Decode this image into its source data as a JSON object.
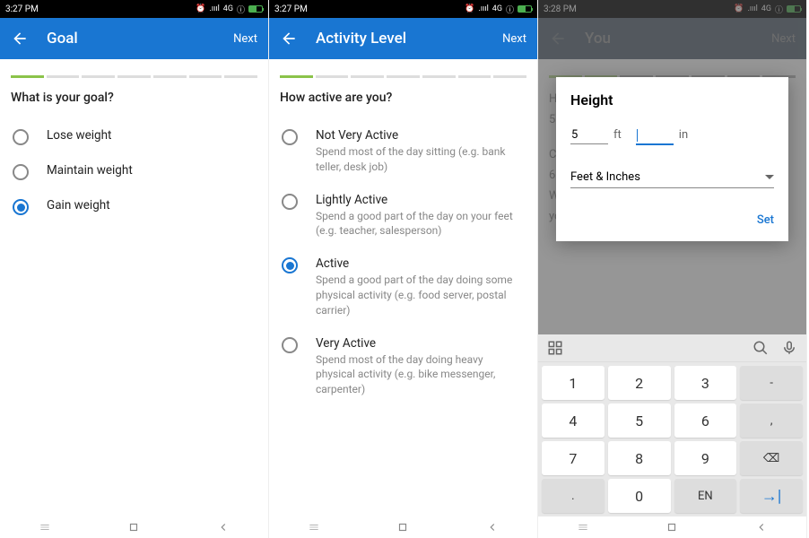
{
  "status": {
    "time_a": "3:27 PM",
    "time_b": "3:27 PM",
    "time_c": "3:28 PM",
    "net": "4G",
    "alarm": "⏰",
    "signal": ".ıııl"
  },
  "screen1": {
    "title": "Goal",
    "next": "Next",
    "question": "What is your goal?",
    "options": [
      {
        "label": "Lose weight"
      },
      {
        "label": "Maintain weight"
      },
      {
        "label": "Gain weight"
      }
    ],
    "selected": 2
  },
  "screen2": {
    "title": "Activity Level",
    "next": "Next",
    "question": "How active are you?",
    "options": [
      {
        "title": "Not Very Active",
        "desc": "Spend most of the day sitting (e.g. bank teller, desk job)"
      },
      {
        "title": "Lightly Active",
        "desc": "Spend a good part of the day on your feet (e.g. teacher, salesperson)"
      },
      {
        "title": "Active",
        "desc": "Spend a good part of the day doing some physical activity (e.g. food server, postal carrier)"
      },
      {
        "title": "Very Active",
        "desc": "Spend most of the day doing heavy physical activity (e.g. bike messenger, carpenter)"
      }
    ],
    "selected": 2
  },
  "screen3": {
    "title": "You",
    "next": "Next",
    "dialog_title": "Height",
    "ft_value": "5",
    "in_value": "",
    "ft_label": "ft",
    "in_label": "in",
    "unit_mode": "Feet & Inches",
    "set": "Set",
    "dim": {
      "q1": "H",
      "v1": "5",
      "q2": "C",
      "v2": "6",
      "q3": "W",
      "v3": "yo"
    }
  },
  "keys": [
    "1",
    "2",
    "3",
    "-",
    "4",
    "5",
    "6",
    ",",
    "7",
    "8",
    "9",
    "⌫",
    ".",
    "0",
    "EN",
    "→|"
  ]
}
